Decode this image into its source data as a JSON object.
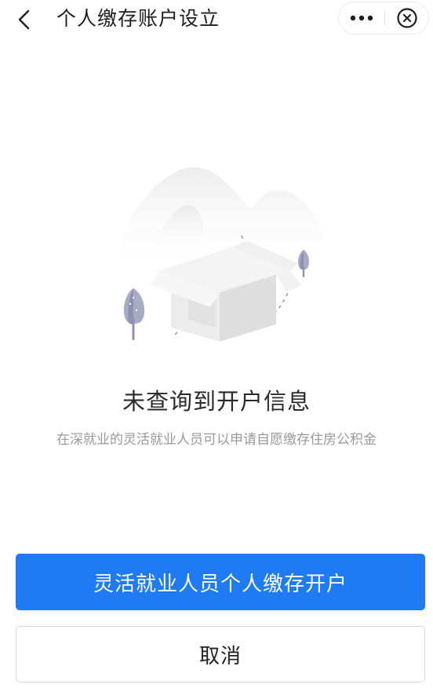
{
  "header": {
    "title": "个人缴存账户设立",
    "back_icon": "chevron-left-icon",
    "more_icon": "more-dots-icon",
    "close_icon": "close-circle-icon"
  },
  "empty_state": {
    "illustration": "empty-box-illustration",
    "title": "未查询到开户信息",
    "description": "在深就业的灵活就业人员可以申请自愿缴存住房公积金"
  },
  "actions": {
    "primary_label": "灵活就业人员个人缴存开户",
    "secondary_label": "取消"
  },
  "colors": {
    "primary": "#1e7bf4",
    "text_main": "#2a2a2a",
    "text_sub": "#9a9a9a"
  }
}
